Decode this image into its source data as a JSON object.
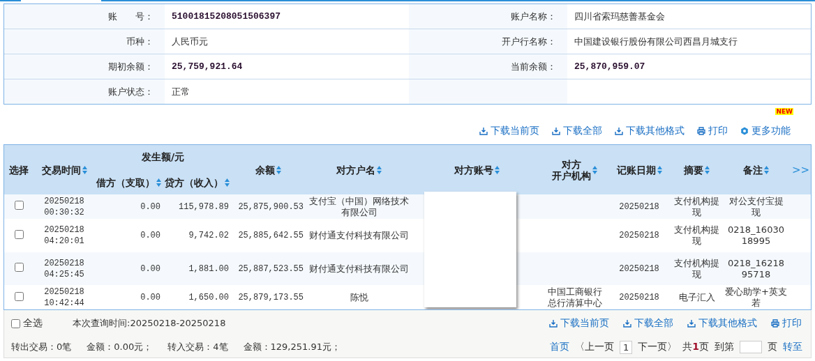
{
  "account_info": {
    "fields": [
      {
        "label": "账　　号：",
        "value": "51001815208051506397",
        "kind": "amount"
      },
      {
        "label": "账户名称：",
        "value": "四川省索玛慈善基金会",
        "kind": "text"
      },
      {
        "label": "币种：",
        "value": "人民币元",
        "kind": "text"
      },
      {
        "label": "开户行名称：",
        "value": "中国建设银行股份有限公司西昌月城支行",
        "kind": "text"
      },
      {
        "label": "期初余额：",
        "value": "25,759,921.64",
        "kind": "amount"
      },
      {
        "label": "当前余额：",
        "value": "25,870,959.07",
        "kind": "amount"
      },
      {
        "label": "账户状态：",
        "value": "正常",
        "kind": "text"
      }
    ]
  },
  "toolbar": {
    "actions": [
      {
        "label": "下载当前页",
        "kind": "download"
      },
      {
        "label": "下载全部",
        "kind": "download"
      },
      {
        "label": "下载其他格式",
        "kind": "download"
      },
      {
        "label": "打印",
        "kind": "print"
      },
      {
        "label": "更多功能",
        "kind": "more",
        "badge": "NEW"
      }
    ]
  },
  "table": {
    "columns": [
      {
        "label": "选择",
        "sortable": false
      },
      {
        "label": "交易时间",
        "sortable": true
      },
      {
        "label": "发生额/元",
        "children": [
          {
            "label": "借方（支取）",
            "sortable": true
          },
          {
            "label": "贷方（收入）",
            "sortable": true
          }
        ]
      },
      {
        "label": "余额",
        "sortable": true
      },
      {
        "label": "对方户名",
        "sortable": true
      },
      {
        "label": "对方账号",
        "sortable": true
      },
      {
        "label": "对方",
        "label_line_2": "开户机构",
        "sortable": true
      },
      {
        "label": "记账日期",
        "sortable": true
      },
      {
        "label": "摘要",
        "sortable": true
      },
      {
        "label": "备注",
        "sortable": true
      }
    ],
    "more": ">>",
    "rows": [
      {
        "checked": false,
        "time": "20250218 00:30:32",
        "debit": "0.00",
        "credit": "115,978.89",
        "balance": "25,875,900.53",
        "counterparty": "支付宝（中国）网络技术有限公司",
        "date": "20250218",
        "summary": "支付机构提现",
        "note": "对公支付宝提现"
      },
      {
        "checked": false,
        "time": "20250218 04:20:01",
        "debit": "0.00",
        "credit": "9,742.02",
        "balance": "25,885,642.55",
        "counterparty": "财付通支付科技有限公司",
        "date": "20250218",
        "summary": "支付机构提现",
        "note": "0218_1603018995"
      },
      {
        "checked": false,
        "time": "20250218 04:25:45",
        "debit": "0.00",
        "credit": "1,881.00",
        "balance": "25,887,523.55",
        "counterparty": "财付通支付科技有限公司",
        "date": "20250218",
        "summary": "支付机构提现",
        "note": "0218_1621895718"
      },
      {
        "checked": false,
        "time": "20250218 10:42:44",
        "debit": "0.00",
        "credit": "1,650.00",
        "balance": "25,879,173.55",
        "counterparty": "陈悦",
        "bank": "中国工商银行总行清算中心",
        "date": "20250218",
        "summary": "电子汇入",
        "note": "爱心助学+英支若"
      }
    ]
  },
  "footer": {
    "select_all": {
      "label": "全选",
      "checked": false
    },
    "query_time": "本次查询时间:20250218-20250218",
    "actions": [
      {
        "label": "下载当前页",
        "kind": "download"
      },
      {
        "label": "下载全部",
        "kind": "download"
      },
      {
        "label": "下载其他格式",
        "kind": "download"
      },
      {
        "label": "打印",
        "kind": "print"
      }
    ],
    "summary": [
      "转出交易：0笔",
      "金额：0.00元；",
      "转入交易：4笔",
      "金额：129,251.91元；"
    ],
    "pagination": {
      "first": "首页",
      "prev": "〈上一页",
      "current": "1",
      "next": "下一页〉",
      "total": "共**1**页",
      "goto_prefix": "到第",
      "goto_suffix": "页",
      "go": "转至"
    }
  }
}
